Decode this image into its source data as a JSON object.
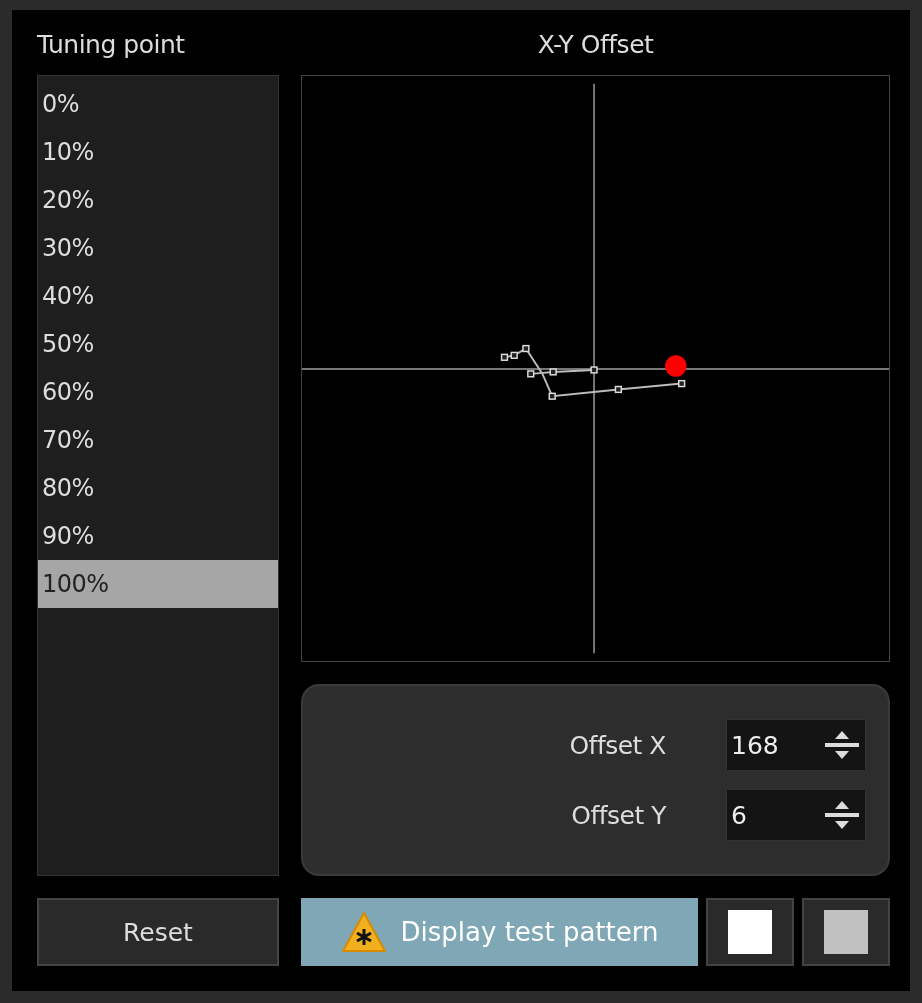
{
  "tuning_point": {
    "title": "Tuning point",
    "items": [
      {
        "label": "0%",
        "selected": false
      },
      {
        "label": "10%",
        "selected": false
      },
      {
        "label": "20%",
        "selected": false
      },
      {
        "label": "30%",
        "selected": false
      },
      {
        "label": "40%",
        "selected": false
      },
      {
        "label": "50%",
        "selected": false
      },
      {
        "label": "60%",
        "selected": false
      },
      {
        "label": "70%",
        "selected": false
      },
      {
        "label": "80%",
        "selected": false
      },
      {
        "label": "90%",
        "selected": false
      },
      {
        "label": "100%",
        "selected": true
      }
    ]
  },
  "xy_offset": {
    "title": "X-Y Offset"
  },
  "offsets": [
    {
      "label": "Offset X",
      "value": "168"
    },
    {
      "label": "Offset Y",
      "value": "6"
    }
  ],
  "buttons": {
    "reset": "Reset",
    "test_pattern": "Display test pattern"
  },
  "swatches": [
    {
      "color": "#ffffff"
    },
    {
      "color": "#c0c0c0"
    }
  ]
}
